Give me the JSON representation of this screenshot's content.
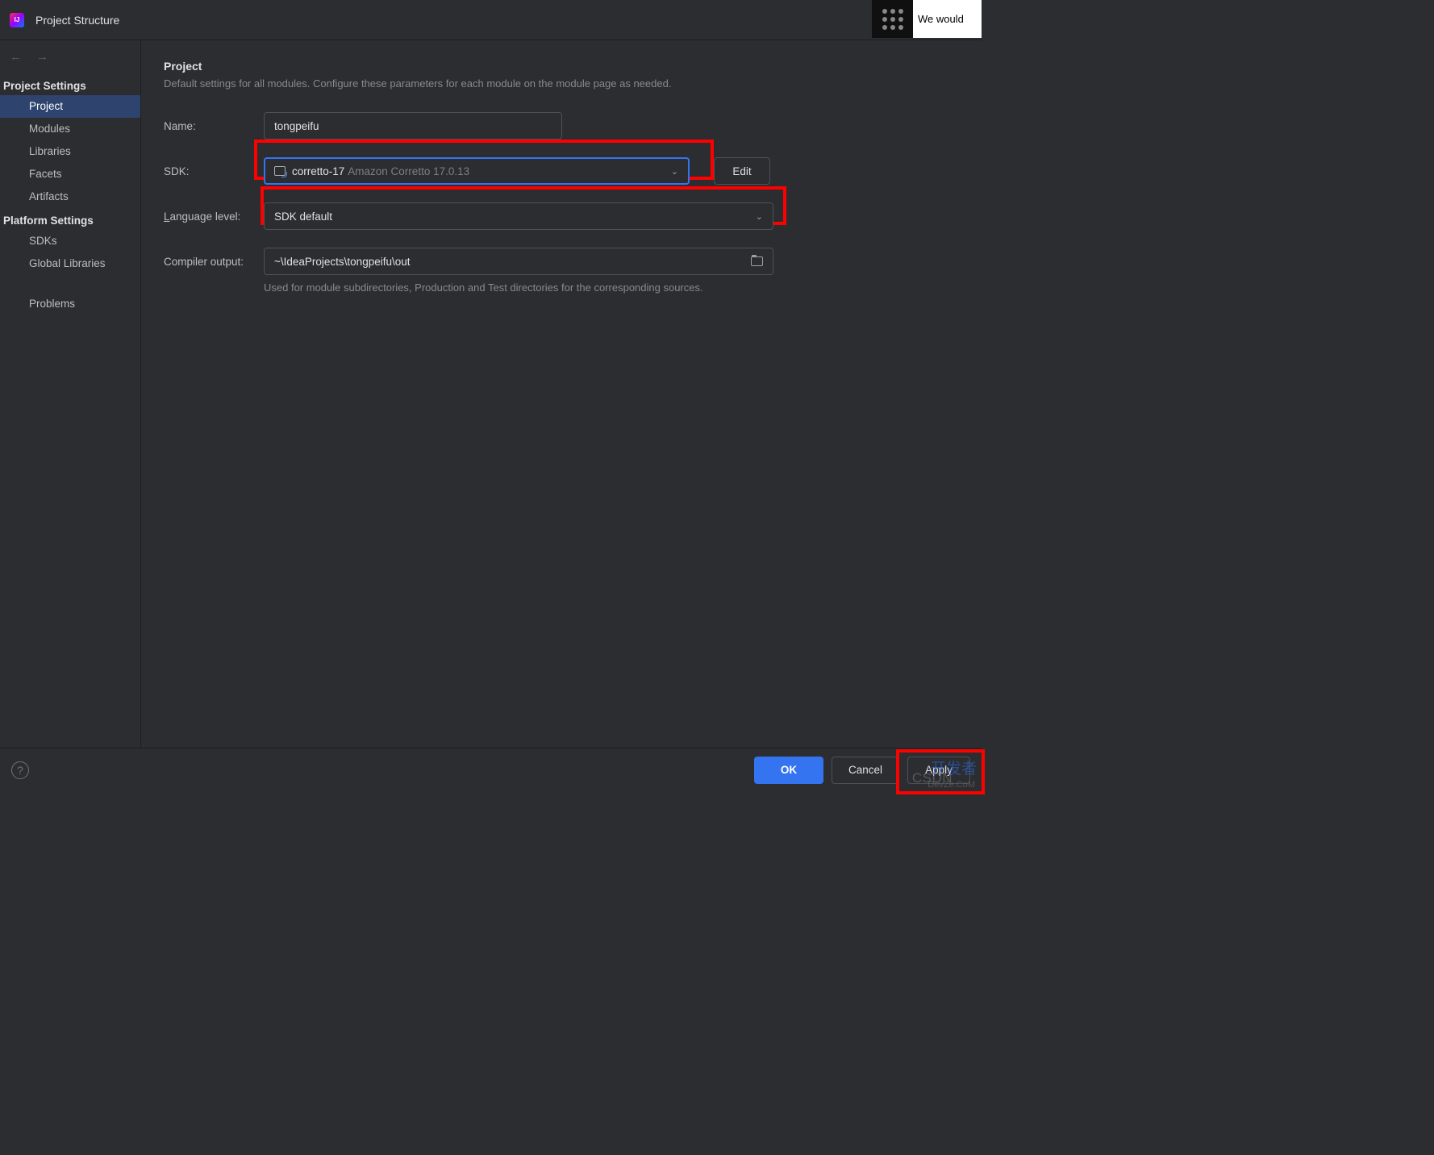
{
  "window": {
    "title": "Project Structure",
    "we_would": "We would"
  },
  "sidebar": {
    "headings": {
      "project": "Project Settings",
      "platform": "Platform Settings"
    },
    "items": {
      "project": "Project",
      "modules": "Modules",
      "libraries": "Libraries",
      "facets": "Facets",
      "artifacts": "Artifacts",
      "sdks": "SDKs",
      "global_libs": "Global Libraries",
      "problems": "Problems"
    }
  },
  "main": {
    "title": "Project",
    "description": "Default settings for all modules. Configure these parameters for each module on the module page as needed.",
    "labels": {
      "name": "Name:",
      "sdk": "SDK:",
      "lang_prefix": "L",
      "lang_rest": "anguage level:",
      "output": "Compiler output:"
    },
    "values": {
      "name": "tongpeifu",
      "sdk_name": "corretto-17",
      "sdk_hint": "Amazon Corretto 17.0.13",
      "lang_level": "SDK default",
      "output_path": "~\\IdeaProjects\\tongpeifu\\out"
    },
    "edit_btn": "Edit",
    "output_hint": "Used for module subdirectories, Production and Test directories for the corresponding sources."
  },
  "footer": {
    "ok": "OK",
    "cancel": "Cancel",
    "apply": "Apply"
  },
  "watermark": {
    "dev": "开发者",
    "csdn": "CSDN",
    "sub": "DevZe.CoM"
  }
}
